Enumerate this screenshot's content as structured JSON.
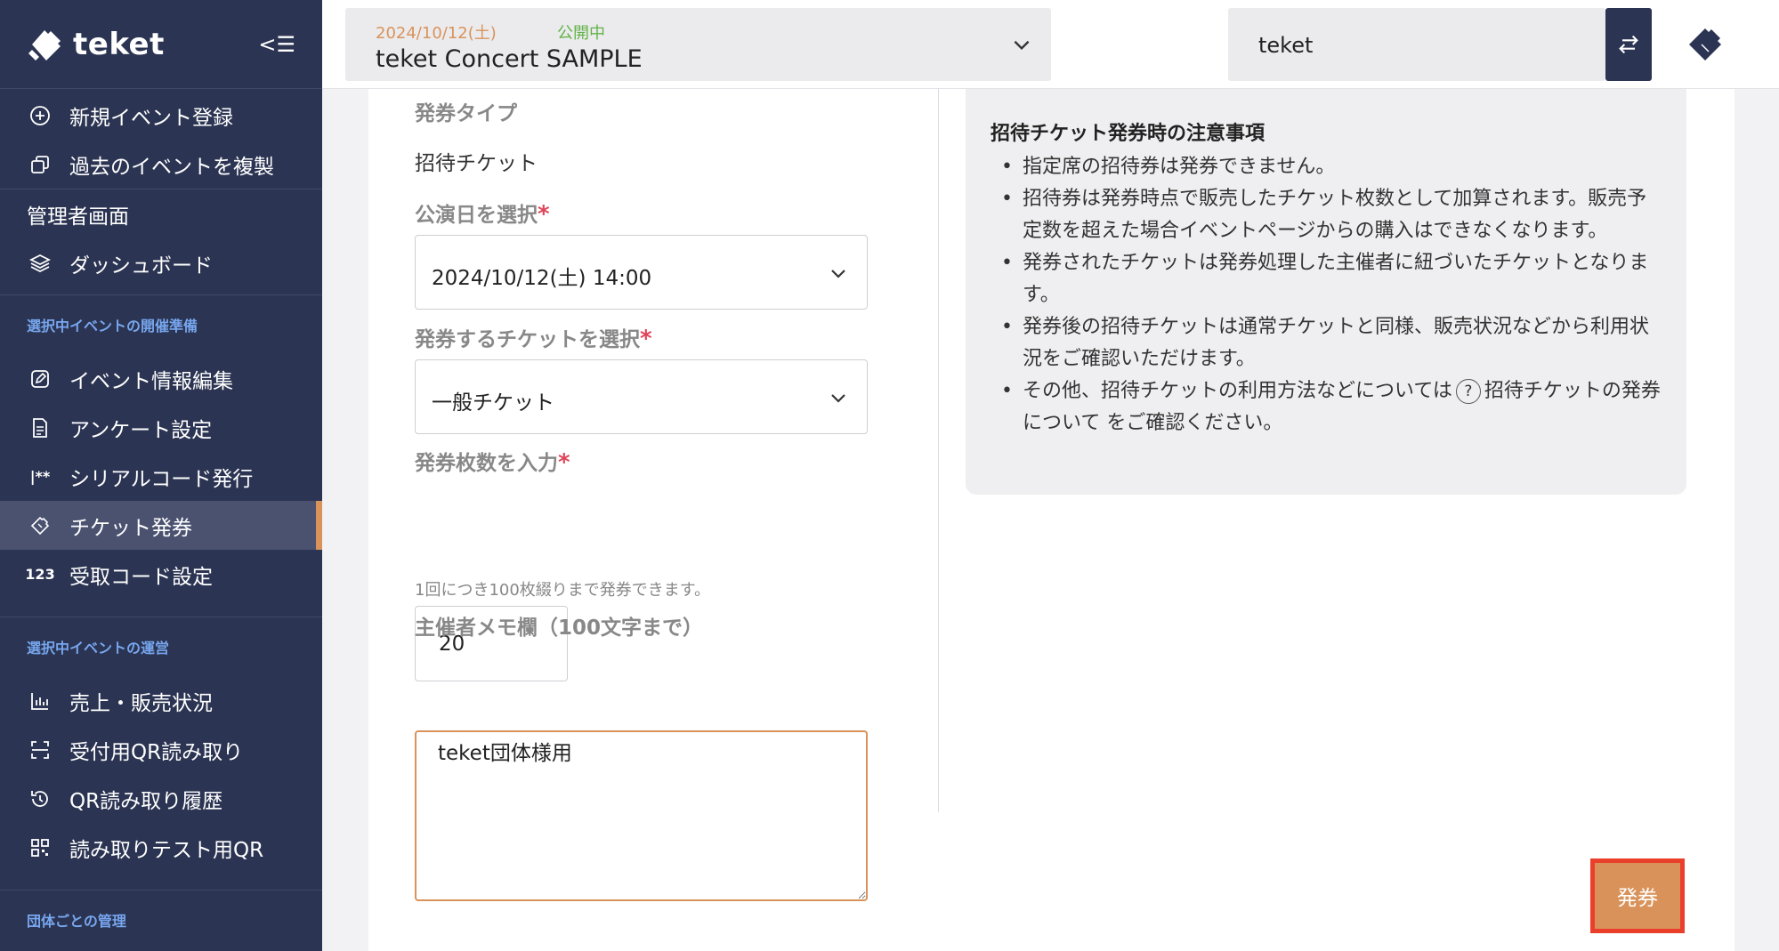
{
  "app": {
    "name": "teket"
  },
  "sidebar": {
    "collapse_label": "<☰",
    "top_items": [
      {
        "label": "新規イベント登録",
        "icon": "plus-circle-icon"
      },
      {
        "label": "過去のイベントを複製",
        "icon": "copy-icon"
      }
    ],
    "admin_label": "管理者画面",
    "dashboard_label": "ダッシュボード",
    "section_prep": "選択中イベントの開催準備",
    "prep_items": [
      {
        "label": "イベント情報編集",
        "icon": "edit-icon"
      },
      {
        "label": "アンケート設定",
        "icon": "document-icon"
      },
      {
        "label": "シリアルコード発行",
        "icon": "serial-code-icon",
        "icon_text": "|**"
      },
      {
        "label": "チケット発券",
        "icon": "ticket-icon",
        "active": true
      },
      {
        "label": "受取コード設定",
        "icon": "number-icon",
        "icon_text": "123"
      }
    ],
    "section_ops": "選択中イベントの運営",
    "ops_items": [
      {
        "label": "売上・販売状況",
        "icon": "bar-chart-icon"
      },
      {
        "label": "受付用QR読み取り",
        "icon": "scan-icon"
      },
      {
        "label": "QR読み取り履歴",
        "icon": "history-icon"
      },
      {
        "label": "読み取りテスト用QR",
        "icon": "qr-code-icon"
      }
    ],
    "section_org": "団体ごとの管理"
  },
  "header": {
    "event_date": "2024/10/12(土)",
    "event_status": "公開中",
    "event_title": "teket Concert SAMPLE",
    "org_name": "teket"
  },
  "form": {
    "type_label": "発券タイプ",
    "type_value": "招待チケット",
    "date_label": "公演日を選択",
    "date_value": "2024/10/12(土) 14:00",
    "ticket_label": "発券するチケットを選択",
    "ticket_value": "一般チケット",
    "qty_label": "発券枚数を入力",
    "qty_hint": "1回につき100枚綴りまで発券できます。",
    "qty_value": "20",
    "memo_label": "主催者メモ欄（100文字まで）",
    "memo_value": "teket団体様用",
    "required_mark": "*",
    "submit_label": "発券"
  },
  "notice": {
    "title": "招待チケット発券時の注意事項",
    "items": [
      "指定席の招待券は発券できません。",
      "招待券は発券時点で販売したチケット枚数として加算されます。販売予定数を超えた場合イベントページからの購入はできなくなります。",
      "発券されたチケットは発券処理した主催者に紐づいたチケットとなります。",
      "発券後の招待チケットは通常チケットと同様、販売状況などから利用状況をご確認いただけます。"
    ],
    "last_item_prefix": "その他、招待チケットの利用方法などについては",
    "last_item_link": "招待チケットの発券について",
    "last_item_suffix": "をご確認ください。"
  },
  "colors": {
    "sidebar_bg": "#2b3452",
    "accent": "#d9935a",
    "status_green": "#62b346",
    "required": "#e0455a",
    "section_label": "#77a6ee"
  }
}
